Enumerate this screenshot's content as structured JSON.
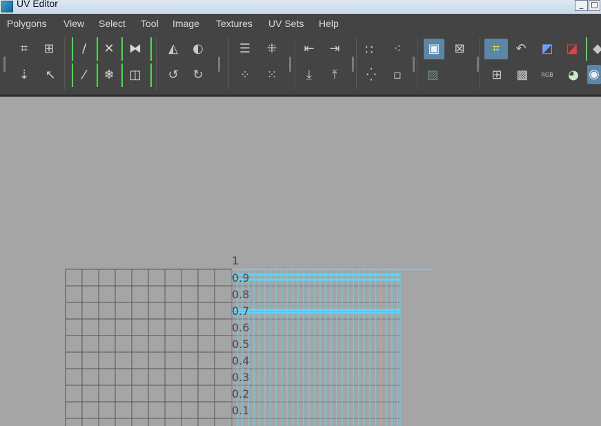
{
  "window": {
    "title": "UV Editor",
    "minimize": "_",
    "maximize": "□"
  },
  "menu": [
    "Polygons",
    "View",
    "Select",
    "Tool",
    "Image",
    "Textures",
    "UV Sets",
    "Help"
  ],
  "toolbar": {
    "icons": [
      "grid-select-icon",
      "move-cluster-icon",
      "lasso-select-icon",
      "pointer-select-icon",
      "cut-icon",
      "sew-icon",
      "split-icon",
      "merge-icon",
      "unfold-icon",
      "relax-icon",
      "straighten-icon",
      "layout-icon",
      "flip-u-icon",
      "flip-v-icon",
      "rotate-ccw-icon",
      "rotate-cw-icon",
      "stack-icon",
      "grid-dots-icon",
      "scatter-icon",
      "pack-icon",
      "align-left-icon",
      "align-right-icon",
      "align-bottom-icon",
      "align-top-icon",
      "snap-dots-icon",
      "snap-add-icon",
      "snap-grid-icon",
      "snap-minus-icon",
      "image-icon",
      "image-dim-icon",
      "checker-swap-icon",
      "uv-grid-icon",
      "uv-shell-icon",
      "rotate-icon",
      "shade-uv-icon",
      "distortion-icon",
      "checker-icon",
      "rgb-channel-icon",
      "alpha-icon",
      "color-wheel-icon"
    ],
    "rgb_label": "RGB"
  },
  "viewport": {
    "background": "#a5a5a5",
    "y_axis_ticks": [
      "1",
      "0.9",
      "0.8",
      "0.7",
      "0.6",
      "0.5",
      "0.4",
      "0.3",
      "0.2",
      "0.1"
    ],
    "grid_color": "#555555",
    "uv_color": "#5fd6f5"
  }
}
